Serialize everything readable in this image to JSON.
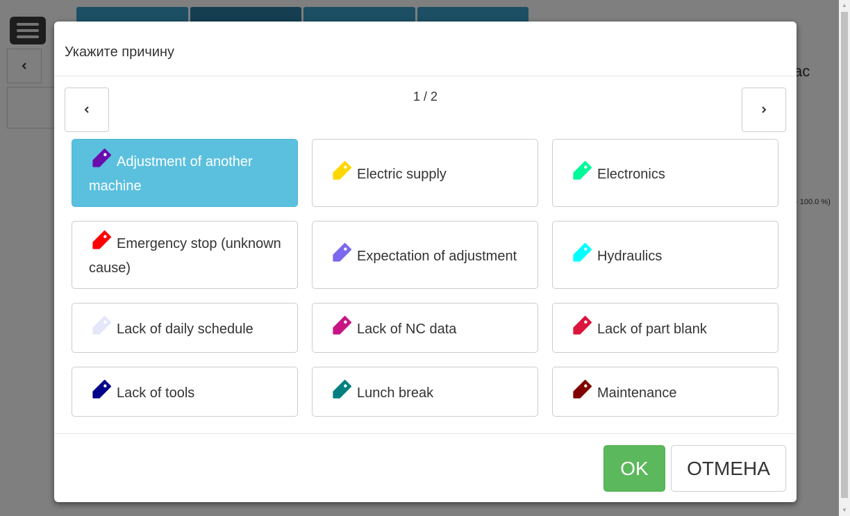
{
  "background": {
    "right_text": "ас",
    "percent_text": "- 100.0 %)"
  },
  "dialog": {
    "title": "Укажите причину",
    "page_indicator": "1 / 2",
    "reasons": [
      {
        "label": "Adjustment of another machine",
        "color": "#6a0dad",
        "selected": true
      },
      {
        "label": "Electric supply",
        "color": "#ffd700",
        "selected": false
      },
      {
        "label": "Electronics",
        "color": "#00fa9a",
        "selected": false
      },
      {
        "label": "Emergency stop (unknown cause)",
        "color": "#ff0000",
        "selected": false
      },
      {
        "label": "Expectation of adjustment",
        "color": "#7b68ee",
        "selected": false
      },
      {
        "label": "Hydraulics",
        "color": "#00ffff",
        "selected": false
      },
      {
        "label": "Lack of daily schedule",
        "color": "#e6e6fa",
        "selected": false
      },
      {
        "label": "Lack of NC data",
        "color": "#c71585",
        "selected": false
      },
      {
        "label": "Lack of part blank",
        "color": "#dc143c",
        "selected": false
      },
      {
        "label": "Lack of tools",
        "color": "#00008b",
        "selected": false
      },
      {
        "label": "Lunch break",
        "color": "#008080",
        "selected": false
      },
      {
        "label": "Maintenance",
        "color": "#800000",
        "selected": false
      }
    ],
    "ok_label": "OK",
    "cancel_label": "ОТМЕНА"
  }
}
